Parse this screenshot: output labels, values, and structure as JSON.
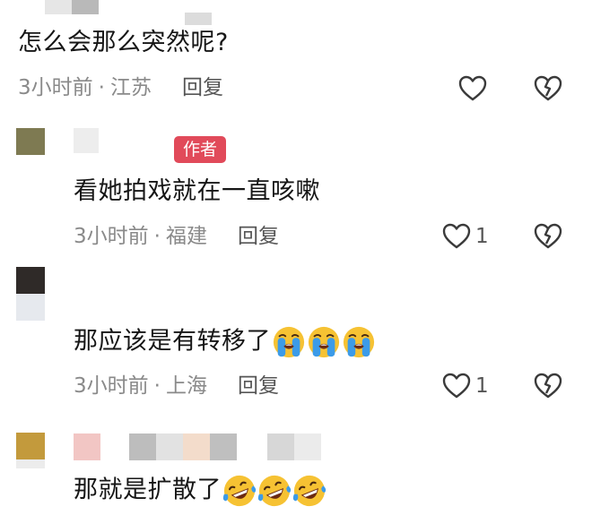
{
  "colors": {
    "badge_red": "#e14a5a",
    "meta_gray": "#8a8a8a",
    "icon_gray": "#3a3a3a",
    "emoji_yellow": "#f6c233",
    "emoji_tear": "#3c9be8"
  },
  "comments": [
    {
      "text": "怎么会那么突然呢?",
      "time": "3小时前",
      "location": "江苏",
      "reply_label": "回复",
      "like_count": "",
      "like_icon": "heart-outline-icon",
      "dislike_icon": "broken-heart-icon"
    },
    {
      "author_badge": "作者",
      "text": "看她拍戏就在一直咳嗽",
      "time": "3小时前",
      "location": "福建",
      "reply_label": "回复",
      "like_count": "1",
      "like_icon": "heart-outline-icon",
      "dislike_icon": "broken-heart-icon"
    },
    {
      "text": "那应该是有转移了",
      "emoji": [
        "loudly-crying-emoji",
        "loudly-crying-emoji",
        "loudly-crying-emoji"
      ],
      "time": "3小时前",
      "location": "上海",
      "reply_label": "回复",
      "like_count": "1",
      "like_icon": "heart-outline-icon",
      "dislike_icon": "broken-heart-icon"
    },
    {
      "text": "那就是扩散了",
      "emoji": [
        "tears-of-joy-emoji",
        "tears-of-joy-emoji",
        "tears-of-joy-emoji"
      ]
    }
  ]
}
